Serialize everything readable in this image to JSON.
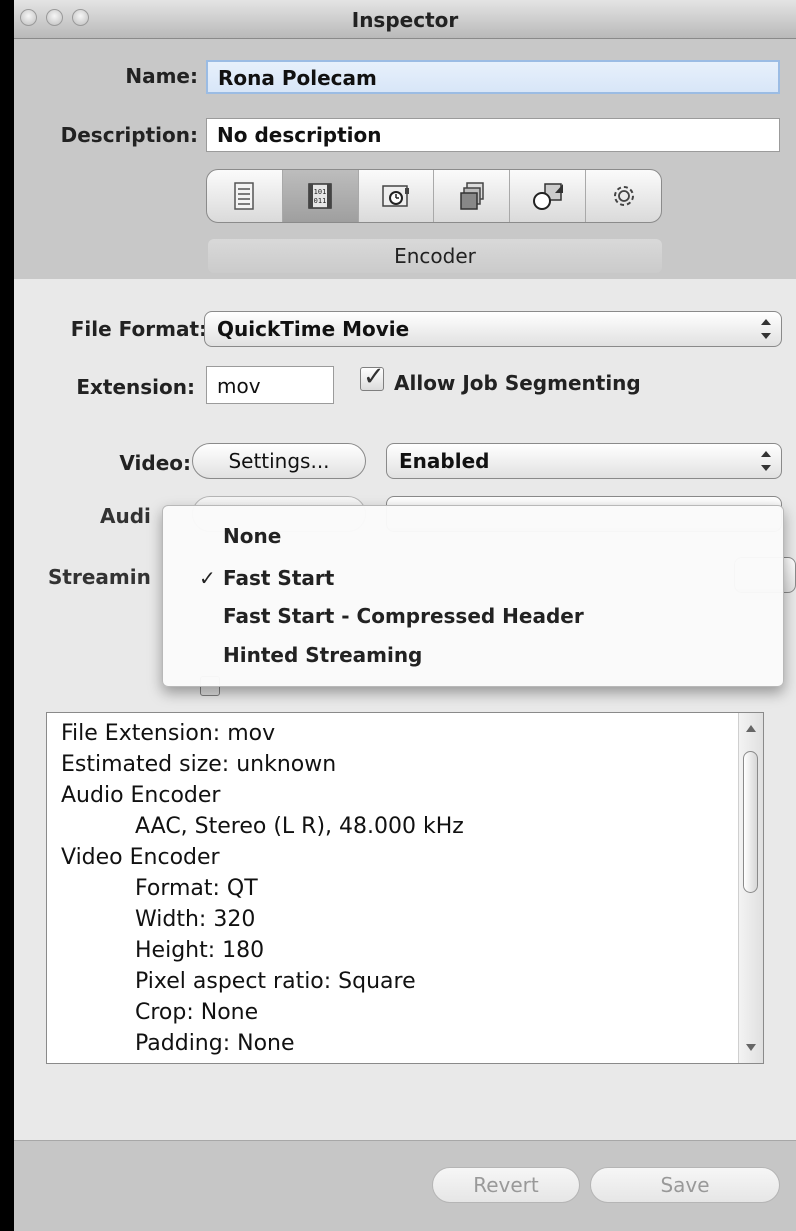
{
  "window": {
    "title": "Inspector"
  },
  "name_label": "Name:",
  "name_value": "Rona Polecam",
  "description_label": "Description:",
  "description_value": "No description",
  "toolbar_tabs": [
    {
      "icon": "summary-icon"
    },
    {
      "icon": "encoder-icon",
      "selected": true
    },
    {
      "icon": "frame-controls-icon"
    },
    {
      "icon": "filters-icon"
    },
    {
      "icon": "geometry-icon"
    },
    {
      "icon": "actions-icon"
    }
  ],
  "active_tab_label": "Encoder",
  "file_format_label": "File Format:",
  "file_format_value": "QuickTime Movie",
  "extension_label": "Extension:",
  "extension_value": "mov",
  "allow_segmenting_label": "Allow Job Segmenting",
  "allow_segmenting_checked": true,
  "video_label": "Video:",
  "video_settings_button": "Settings...",
  "video_status": "Enabled",
  "audio_label_visible": "Audi",
  "streaming_label_visible": "Streamin",
  "streaming_menu": {
    "options": [
      "None",
      "Fast Start",
      "Fast Start - Compressed Header",
      "Hinted Streaming"
    ],
    "selected": "Fast Start",
    "check_glyph": "✓"
  },
  "info_lines": [
    {
      "text": "File Extension: mov",
      "indent": false
    },
    {
      "text": "Estimated size: unknown",
      "indent": false
    },
    {
      "text": "Audio Encoder",
      "indent": false
    },
    {
      "text": "AAC, Stereo (L R), 48.000 kHz",
      "indent": true
    },
    {
      "text": "Video Encoder",
      "indent": false
    },
    {
      "text": "Format: QT",
      "indent": true
    },
    {
      "text": "Width: 320",
      "indent": true
    },
    {
      "text": "Height: 180",
      "indent": true
    },
    {
      "text": "Pixel aspect ratio: Square",
      "indent": true
    },
    {
      "text": "Crop: None",
      "indent": true
    },
    {
      "text": "Padding: None",
      "indent": true
    }
  ],
  "revert_button": "Revert",
  "save_button": "Save"
}
